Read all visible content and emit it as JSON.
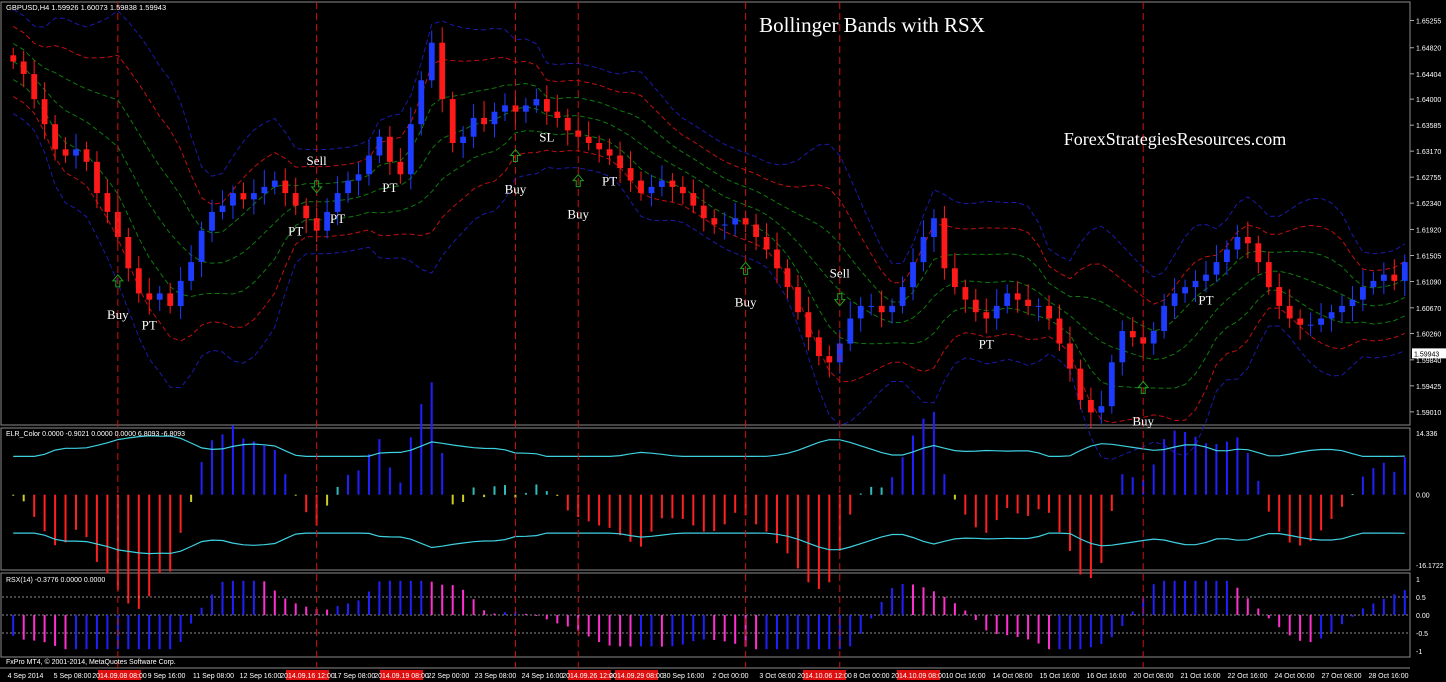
{
  "chart_data": {
    "type": "candlestick",
    "title": "Bollinger Bands with RSX",
    "watermark": "ForexStrategiesResources.com",
    "main": {
      "symbol_info": "GBPUSD,H4  1.59926 1.60073 1.59838 1.59943",
      "price_ticks": [
        "1.65255",
        "1.64820",
        "1.64404",
        "1.64000",
        "1.63585",
        "1.63170",
        "1.62755",
        "1.62340",
        "1.61920",
        "1.61505",
        "1.61090",
        "1.60670",
        "1.60260",
        "1.59840",
        "1.59425",
        "1.59010"
      ],
      "price_tick_values": [
        1.65255,
        1.6482,
        1.64404,
        1.64,
        1.63585,
        1.6317,
        1.62755,
        1.6234,
        1.6192,
        1.61505,
        1.6109,
        1.6067,
        1.6026,
        1.5984,
        1.59425,
        1.5901
      ],
      "ylim": [
        1.588,
        1.6555
      ],
      "current_price": "1.59943",
      "current_price_value": 1.59943,
      "close_path": [
        1.646,
        1.644,
        1.64,
        1.636,
        1.632,
        1.631,
        1.632,
        1.63,
        1.625,
        1.622,
        1.618,
        1.613,
        1.609,
        1.608,
        1.609,
        1.607,
        1.611,
        1.614,
        1.619,
        1.622,
        1.623,
        1.625,
        1.624,
        1.625,
        1.626,
        1.627,
        1.625,
        1.623,
        1.621,
        1.619,
        1.622,
        1.625,
        1.627,
        1.628,
        1.631,
        1.634,
        1.63,
        1.628,
        1.636,
        1.643,
        1.649,
        1.64,
        1.633,
        1.634,
        1.637,
        1.636,
        1.638,
        1.639,
        1.638,
        1.639,
        1.64,
        1.638,
        1.637,
        1.635,
        1.634,
        1.633,
        1.632,
        1.631,
        1.629,
        1.627,
        1.625,
        1.626,
        1.627,
        1.626,
        1.625,
        1.623,
        1.621,
        1.62,
        1.62,
        1.621,
        1.62,
        1.618,
        1.616,
        1.613,
        1.61,
        1.606,
        1.602,
        1.599,
        1.598,
        1.601,
        1.605,
        1.607,
        1.607,
        1.606,
        1.607,
        1.61,
        1.614,
        1.618,
        1.621,
        1.613,
        1.61,
        1.608,
        1.606,
        1.605,
        1.607,
        1.609,
        1.608,
        1.607,
        1.607,
        1.605,
        1.601,
        1.597,
        1.592,
        1.59,
        1.591,
        1.598,
        1.603,
        1.602,
        1.601,
        1.603,
        1.607,
        1.609,
        1.61,
        1.611,
        1.612,
        1.614,
        1.616,
        1.618,
        1.617,
        1.614,
        1.61,
        1.607,
        1.605,
        1.604,
        1.604,
        1.605,
        1.606,
        1.607,
        1.608,
        1.61,
        1.611,
        1.612,
        1.611,
        1.614
      ]
    },
    "x_ticks": [
      {
        "label": "4 Sep 2014",
        "hl": false
      },
      {
        "label": "5 Sep 08:00",
        "hl": false
      },
      {
        "label": "2014.09.08 08:00",
        "hl": true
      },
      {
        "label": "9 Sep 16:00",
        "hl": false
      },
      {
        "label": "11 Sep 08:00",
        "hl": false
      },
      {
        "label": "12 Sep 16:00",
        "hl": false
      },
      {
        "label": "2014.09.16 12:00",
        "hl": true
      },
      {
        "label": "17 Sep 08:00",
        "hl": false
      },
      {
        "label": "2014.09.19 08:00",
        "hl": true
      },
      {
        "label": "22 Sep 00:00",
        "hl": false
      },
      {
        "label": "23 Sep 08:00",
        "hl": false
      },
      {
        "label": "24 Sep 16:00",
        "hl": false
      },
      {
        "label": "2014.09.26 12:00",
        "hl": true
      },
      {
        "label": "2014.09.29 08:00",
        "hl": true
      },
      {
        "label": "30 Sep 16:00",
        "hl": false
      },
      {
        "label": "2 Oct 00:00",
        "hl": false
      },
      {
        "label": "3 Oct 08:00",
        "hl": false
      },
      {
        "label": "2014.10.06 12:00",
        "hl": true
      },
      {
        "label": "8 Oct 00:00",
        "hl": false
      },
      {
        "label": "2014.10.09 08:00",
        "hl": true
      },
      {
        "label": "10 Oct 16:00",
        "hl": false
      },
      {
        "label": "14 Oct 08:00",
        "hl": false
      },
      {
        "label": "15 Oct 16:00",
        "hl": false
      },
      {
        "label": "16 Oct 16:00",
        "hl": false
      },
      {
        "label": "20 Oct 08:00",
        "hl": false
      },
      {
        "label": "21 Oct 16:00",
        "hl": false
      },
      {
        "label": "22 Oct 16:00",
        "hl": false
      },
      {
        "label": "24 Oct 00:00",
        "hl": false
      },
      {
        "label": "27 Oct 08:00",
        "hl": false
      },
      {
        "label": "28 Oct 16:00",
        "hl": false
      }
    ],
    "signals": [
      {
        "label": "Buy",
        "type": "buy",
        "bar": 10
      },
      {
        "label": "Sell",
        "type": "sell",
        "bar": 29
      },
      {
        "label": "Buy",
        "type": "buy",
        "bar": 48
      },
      {
        "label": "Buy",
        "type": "buy",
        "bar": 54
      },
      {
        "label": "Buy",
        "type": "buy",
        "bar": 70
      },
      {
        "label": "Sell",
        "type": "sell",
        "bar": 79
      },
      {
        "label": "Buy",
        "type": "buy",
        "bar": 108
      }
    ],
    "annotations": [
      {
        "label": "PT",
        "bar": 13
      },
      {
        "label": "PT",
        "bar": 27
      },
      {
        "label": "PT",
        "bar": 31
      },
      {
        "label": "PT",
        "bar": 36
      },
      {
        "label": "SL",
        "bar": 51
      },
      {
        "label": "PT",
        "bar": 57
      },
      {
        "label": "PT",
        "bar": 93
      },
      {
        "label": "PT",
        "bar": 114
      }
    ],
    "elr": {
      "label": "ELR_Color 0.0000 -0.9021 0.0000 0.0000 6.8093 -6.8093",
      "ticks": [
        "14.336",
        "0.00",
        "-16.1722"
      ],
      "tick_values": [
        14.336,
        0.0,
        -16.1722
      ],
      "ylim": [
        -16.1722,
        14.336
      ]
    },
    "rsx": {
      "label": "RSX(14) -0.3776 0.0000 0.0000",
      "ticks": [
        "1",
        "0.5",
        "0.00",
        "-0.5",
        "-1"
      ],
      "tick_values": [
        1,
        0.5,
        0,
        -0.5,
        -1
      ],
      "ylim": [
        -1,
        1
      ]
    },
    "copyright": "FxPro MT4, © 2001-2014, MetaQuotes Software Corp."
  }
}
